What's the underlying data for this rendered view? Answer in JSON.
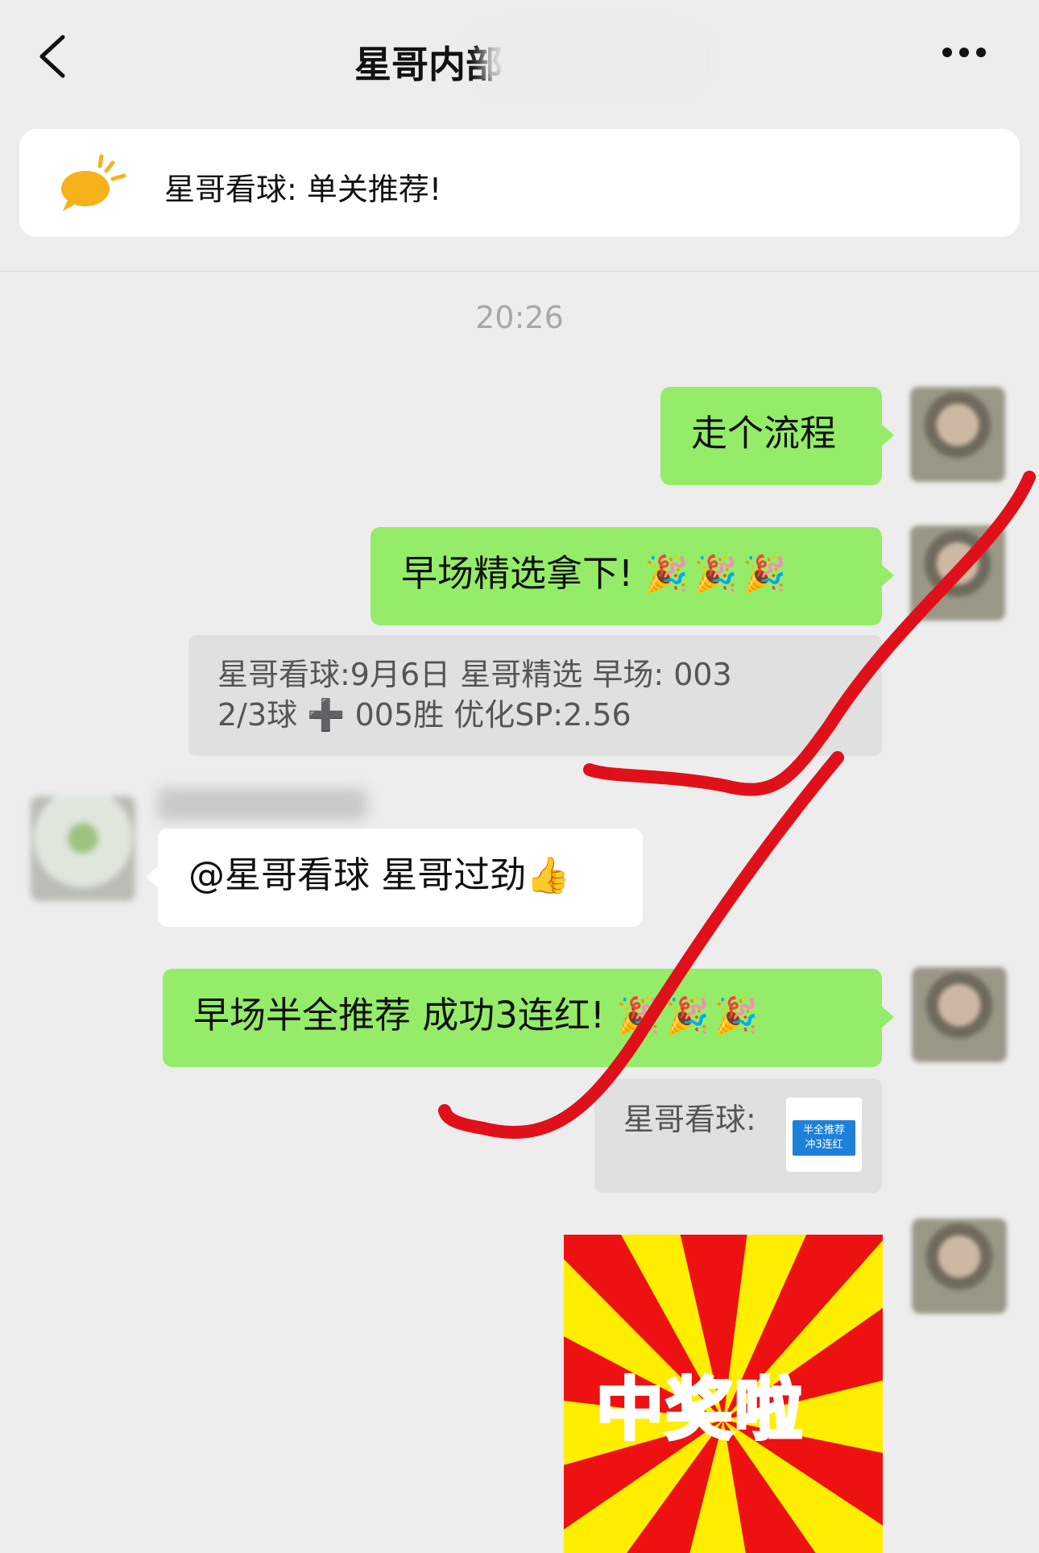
{
  "header": {
    "title": "星哥内部",
    "back_icon": "chevron-left-icon",
    "more_icon": "more-dots-icon"
  },
  "notice": {
    "icon": "announcement-bubble-icon",
    "text": "星哥看球: 单关推荐!"
  },
  "chat": {
    "timestamp": "20:26",
    "messages": [
      {
        "side": "right",
        "text": "走个流程"
      },
      {
        "side": "right",
        "text": "早场精选拿下!",
        "emoji": "🎉🎉🎉"
      },
      {
        "side": "right",
        "type": "quote",
        "line1": "星哥看球:9月6日 星哥精选  早场:   003",
        "line2": "2/3球 ➕ 005胜   优化SP:2.56"
      },
      {
        "side": "left",
        "text": "@星哥看球 星哥过劲",
        "emoji": "👍"
      },
      {
        "side": "right",
        "text": "早场半全推荐 成功3连红!",
        "emoji": "🎉🎉🎉"
      },
      {
        "side": "right",
        "type": "quote",
        "line1": "星哥看球:"
      },
      {
        "side": "right",
        "type": "sticker",
        "text": "中奖啦"
      }
    ],
    "mini_card": {
      "line1": "半全推荐",
      "line2": "冲3连红"
    }
  },
  "colors": {
    "background": "#ededed",
    "bubble_green": "#95ec69",
    "bubble_white": "#ffffff",
    "annotation_red": "#e0101a"
  }
}
